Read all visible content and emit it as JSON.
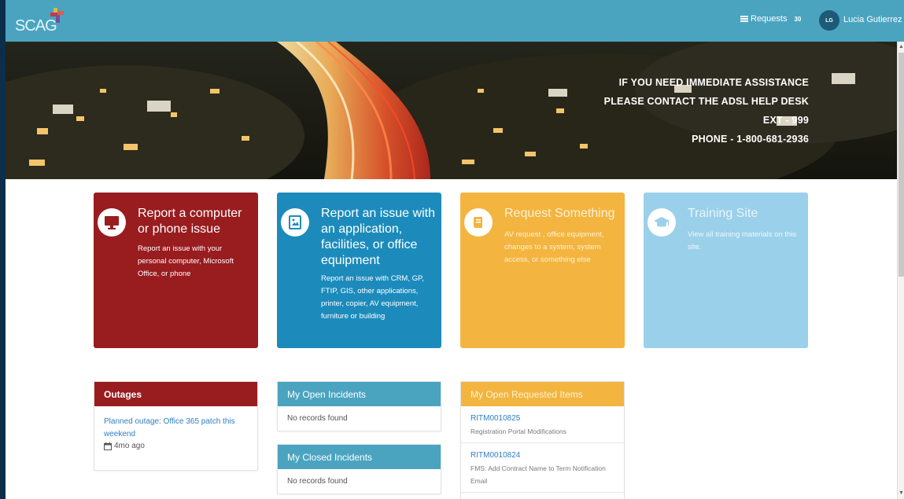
{
  "header": {
    "logo_text": "SCAG",
    "requests_label": "Requests",
    "requests_count": "30",
    "user_initials": "LG",
    "user_name": "Lucia Gutierrez"
  },
  "hero": {
    "line1": "IF YOU NEED IMMEDIATE ASSISTANCE",
    "line2": "PLEASE CONTACT THE ADSL HELP DESK",
    "line3": "EXT - 999",
    "line4": "PHONE - 1-800-681-2936"
  },
  "cards": [
    {
      "title": "Report a computer or phone issue",
      "description": "Report an issue with your personal computer, Microsoft Office, or phone",
      "icon": "monitor-icon",
      "color": "#991c1f"
    },
    {
      "title": "Report an issue with an application, facilities, or office equipment",
      "description": "Report an issue with CRM, GP, FTIP, GIS, other applications, printer, copier, AV equipment, furniture or building",
      "icon": "picture-icon",
      "color": "#1c8bbc"
    },
    {
      "title": "Request Something",
      "description": "AV request , office equipment, changes to a system, system access, or something else",
      "icon": "book-icon",
      "color": "#f3b53f"
    },
    {
      "title": "Training Site",
      "description": "View all training materials on this site.",
      "icon": "graduation-cap-icon",
      "color": "#9bd0ea"
    }
  ],
  "outages": {
    "title": "Outages",
    "item_link": "Planned outage: Office 365 patch this weekend",
    "item_time": "4mo ago"
  },
  "open_incidents": {
    "title": "My Open Incidents",
    "empty": "No records found"
  },
  "closed_incidents": {
    "title": "My Closed Incidents",
    "empty": "No records found"
  },
  "requested_items": {
    "title": "My Open Requested Items",
    "items": [
      {
        "number": "RITM0010825",
        "description": "Registration Portal Modifications"
      },
      {
        "number": "RITM0010824",
        "description": "FMS: Add Contract Name to Term Notification Email"
      }
    ]
  }
}
